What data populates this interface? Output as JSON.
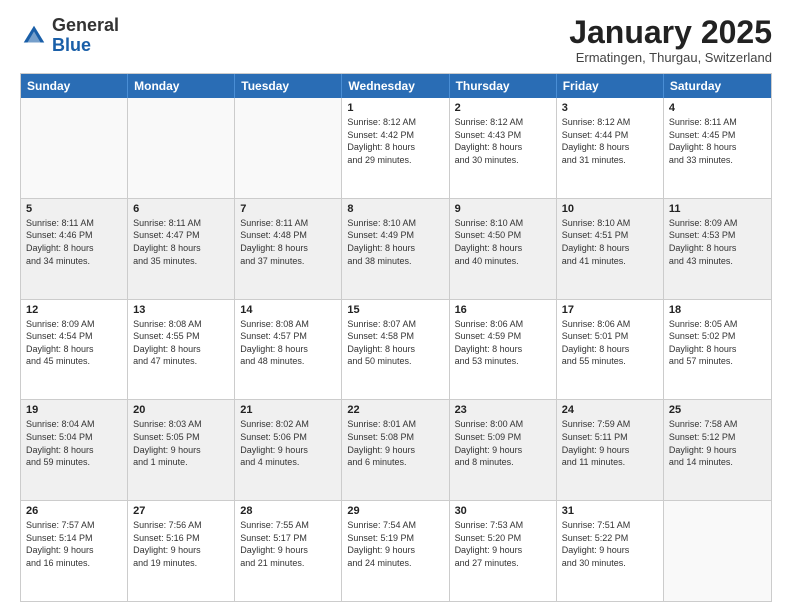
{
  "logo": {
    "general": "General",
    "blue": "Blue"
  },
  "header": {
    "title": "January 2025",
    "subtitle": "Ermatingen, Thurgau, Switzerland"
  },
  "days": [
    "Sunday",
    "Monday",
    "Tuesday",
    "Wednesday",
    "Thursday",
    "Friday",
    "Saturday"
  ],
  "weeks": [
    [
      {
        "day": "",
        "info": ""
      },
      {
        "day": "",
        "info": ""
      },
      {
        "day": "",
        "info": ""
      },
      {
        "day": "1",
        "info": "Sunrise: 8:12 AM\nSunset: 4:42 PM\nDaylight: 8 hours\nand 29 minutes."
      },
      {
        "day": "2",
        "info": "Sunrise: 8:12 AM\nSunset: 4:43 PM\nDaylight: 8 hours\nand 30 minutes."
      },
      {
        "day": "3",
        "info": "Sunrise: 8:12 AM\nSunset: 4:44 PM\nDaylight: 8 hours\nand 31 minutes."
      },
      {
        "day": "4",
        "info": "Sunrise: 8:11 AM\nSunset: 4:45 PM\nDaylight: 8 hours\nand 33 minutes."
      }
    ],
    [
      {
        "day": "5",
        "info": "Sunrise: 8:11 AM\nSunset: 4:46 PM\nDaylight: 8 hours\nand 34 minutes."
      },
      {
        "day": "6",
        "info": "Sunrise: 8:11 AM\nSunset: 4:47 PM\nDaylight: 8 hours\nand 35 minutes."
      },
      {
        "day": "7",
        "info": "Sunrise: 8:11 AM\nSunset: 4:48 PM\nDaylight: 8 hours\nand 37 minutes."
      },
      {
        "day": "8",
        "info": "Sunrise: 8:10 AM\nSunset: 4:49 PM\nDaylight: 8 hours\nand 38 minutes."
      },
      {
        "day": "9",
        "info": "Sunrise: 8:10 AM\nSunset: 4:50 PM\nDaylight: 8 hours\nand 40 minutes."
      },
      {
        "day": "10",
        "info": "Sunrise: 8:10 AM\nSunset: 4:51 PM\nDaylight: 8 hours\nand 41 minutes."
      },
      {
        "day": "11",
        "info": "Sunrise: 8:09 AM\nSunset: 4:53 PM\nDaylight: 8 hours\nand 43 minutes."
      }
    ],
    [
      {
        "day": "12",
        "info": "Sunrise: 8:09 AM\nSunset: 4:54 PM\nDaylight: 8 hours\nand 45 minutes."
      },
      {
        "day": "13",
        "info": "Sunrise: 8:08 AM\nSunset: 4:55 PM\nDaylight: 8 hours\nand 47 minutes."
      },
      {
        "day": "14",
        "info": "Sunrise: 8:08 AM\nSunset: 4:57 PM\nDaylight: 8 hours\nand 48 minutes."
      },
      {
        "day": "15",
        "info": "Sunrise: 8:07 AM\nSunset: 4:58 PM\nDaylight: 8 hours\nand 50 minutes."
      },
      {
        "day": "16",
        "info": "Sunrise: 8:06 AM\nSunset: 4:59 PM\nDaylight: 8 hours\nand 53 minutes."
      },
      {
        "day": "17",
        "info": "Sunrise: 8:06 AM\nSunset: 5:01 PM\nDaylight: 8 hours\nand 55 minutes."
      },
      {
        "day": "18",
        "info": "Sunrise: 8:05 AM\nSunset: 5:02 PM\nDaylight: 8 hours\nand 57 minutes."
      }
    ],
    [
      {
        "day": "19",
        "info": "Sunrise: 8:04 AM\nSunset: 5:04 PM\nDaylight: 8 hours\nand 59 minutes."
      },
      {
        "day": "20",
        "info": "Sunrise: 8:03 AM\nSunset: 5:05 PM\nDaylight: 9 hours\nand 1 minute."
      },
      {
        "day": "21",
        "info": "Sunrise: 8:02 AM\nSunset: 5:06 PM\nDaylight: 9 hours\nand 4 minutes."
      },
      {
        "day": "22",
        "info": "Sunrise: 8:01 AM\nSunset: 5:08 PM\nDaylight: 9 hours\nand 6 minutes."
      },
      {
        "day": "23",
        "info": "Sunrise: 8:00 AM\nSunset: 5:09 PM\nDaylight: 9 hours\nand 8 minutes."
      },
      {
        "day": "24",
        "info": "Sunrise: 7:59 AM\nSunset: 5:11 PM\nDaylight: 9 hours\nand 11 minutes."
      },
      {
        "day": "25",
        "info": "Sunrise: 7:58 AM\nSunset: 5:12 PM\nDaylight: 9 hours\nand 14 minutes."
      }
    ],
    [
      {
        "day": "26",
        "info": "Sunrise: 7:57 AM\nSunset: 5:14 PM\nDaylight: 9 hours\nand 16 minutes."
      },
      {
        "day": "27",
        "info": "Sunrise: 7:56 AM\nSunset: 5:16 PM\nDaylight: 9 hours\nand 19 minutes."
      },
      {
        "day": "28",
        "info": "Sunrise: 7:55 AM\nSunset: 5:17 PM\nDaylight: 9 hours\nand 21 minutes."
      },
      {
        "day": "29",
        "info": "Sunrise: 7:54 AM\nSunset: 5:19 PM\nDaylight: 9 hours\nand 24 minutes."
      },
      {
        "day": "30",
        "info": "Sunrise: 7:53 AM\nSunset: 5:20 PM\nDaylight: 9 hours\nand 27 minutes."
      },
      {
        "day": "31",
        "info": "Sunrise: 7:51 AM\nSunset: 5:22 PM\nDaylight: 9 hours\nand 30 minutes."
      },
      {
        "day": "",
        "info": ""
      }
    ]
  ]
}
